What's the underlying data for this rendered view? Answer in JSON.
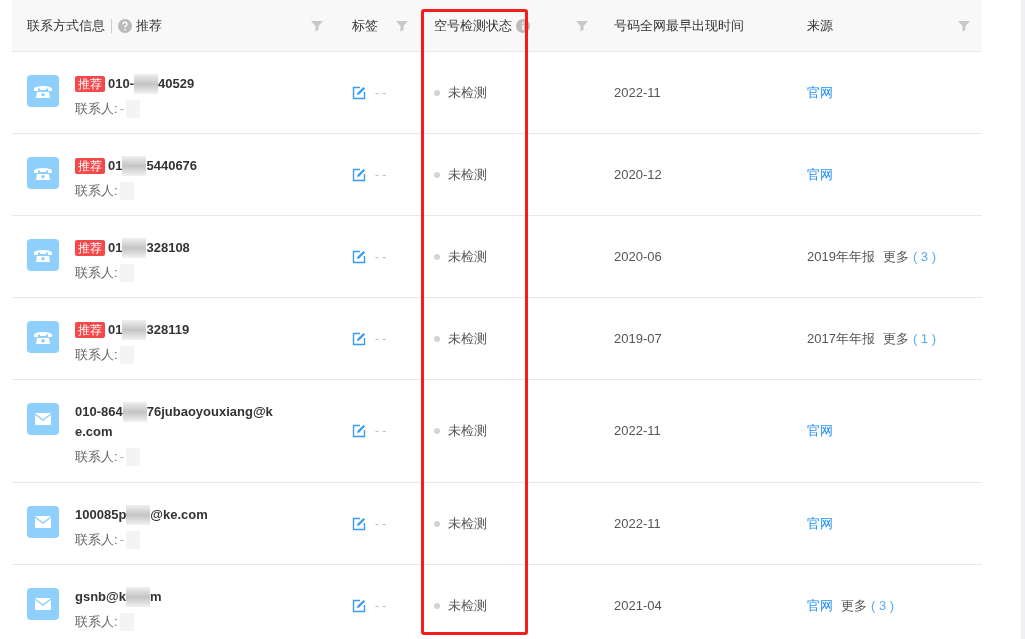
{
  "table": {
    "columns": [
      {
        "label": "联系方式信息",
        "extra_label": "推荐",
        "help": true,
        "filter": true,
        "info": false,
        "highlighted": false
      },
      {
        "label": "标签",
        "filter": true,
        "info": false,
        "highlighted": false
      },
      {
        "label": "空号检测状态",
        "filter": true,
        "info": true,
        "highlighted": true
      },
      {
        "label": "号码全网最早出现时间",
        "filter": false,
        "info": false,
        "highlighted": false
      },
      {
        "label": "来源",
        "filter": true,
        "info": false,
        "highlighted": false
      }
    ],
    "rows": [
      {
        "kind": "phone",
        "recommended": true,
        "badge": "推荐",
        "lines": [
          [
            "010-",
            "40529"
          ]
        ],
        "contact_label": "联系人:",
        "contact_value": "-",
        "tag": "- -",
        "status": "未检测",
        "time": "2022-11",
        "source": [
          {
            "kind": "link",
            "text": "官网"
          }
        ]
      },
      {
        "kind": "phone",
        "recommended": true,
        "badge": "推荐",
        "lines": [
          [
            "01",
            "5440676"
          ]
        ],
        "contact_label": "联系人:",
        "tag": "- -",
        "status": "未检测",
        "time": "2020-12",
        "source": [
          {
            "kind": "link",
            "text": "官网"
          }
        ]
      },
      {
        "kind": "phone",
        "recommended": true,
        "badge": "推荐",
        "lines": [
          [
            "01",
            "328108"
          ]
        ],
        "contact_label": "联系人:",
        "tag": "- -",
        "status": "未检测",
        "time": "2020-06",
        "source": [
          {
            "kind": "text",
            "text": "2019年年报"
          },
          {
            "kind": "more",
            "text": "更多",
            "count": "( 3 )"
          }
        ]
      },
      {
        "kind": "phone",
        "recommended": true,
        "badge": "推荐",
        "lines": [
          [
            "01",
            "328119"
          ]
        ],
        "contact_label": "联系人:",
        "tag": "- -",
        "status": "未检测",
        "time": "2019-07",
        "source": [
          {
            "kind": "text",
            "text": "2017年年报"
          },
          {
            "kind": "more",
            "text": "更多",
            "count": "( 1 )"
          }
        ]
      },
      {
        "kind": "mail",
        "recommended": false,
        "lines": [
          [
            "010-864",
            "76jubaoyouxiang@k"
          ],
          [
            "e.com"
          ]
        ],
        "contact_label": "联系人:",
        "contact_value": "-",
        "tag": "- -",
        "status": "未检测",
        "time": "2022-11",
        "source": [
          {
            "kind": "link",
            "text": "官网"
          }
        ]
      },
      {
        "kind": "mail",
        "recommended": false,
        "lines": [
          [
            "100085p",
            "@ke.com"
          ]
        ],
        "contact_label": "联系人:",
        "contact_value": "-",
        "tag": "- -",
        "status": "未检测",
        "time": "2022-11",
        "source": [
          {
            "kind": "link",
            "text": "官网"
          }
        ]
      },
      {
        "kind": "mail",
        "recommended": false,
        "lines": [
          [
            "gsnb@k",
            "m"
          ]
        ],
        "contact_label": "联系人:",
        "tag": "- -",
        "status": "未检测",
        "time": "2021-04",
        "source": [
          {
            "kind": "link",
            "text": "官网"
          },
          {
            "kind": "more",
            "text": "更多",
            "count": "( 3 )"
          }
        ]
      }
    ]
  }
}
